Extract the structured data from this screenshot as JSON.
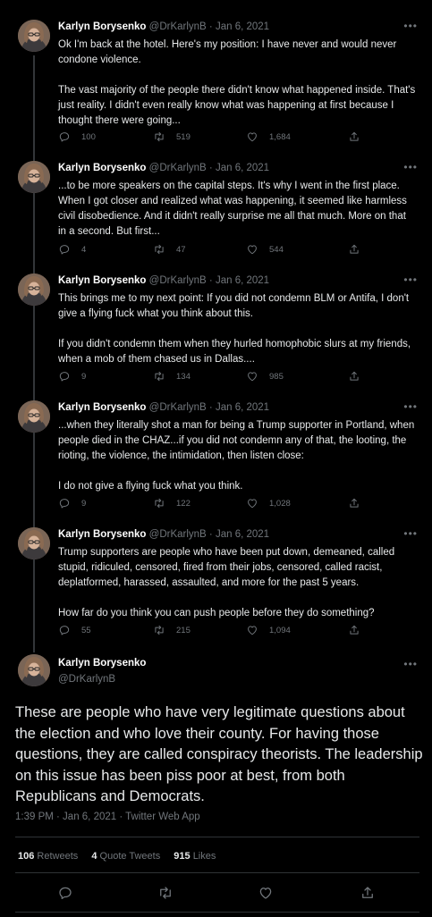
{
  "tweets": [
    {
      "author": "Karlyn Borysenko",
      "handle": "@DrKarlynB",
      "date": "Jan 6, 2021",
      "paragraphs": [
        "Ok I'm back at the hotel. Here's my position: I have never and would never condone violence.",
        "The vast majority of the people there didn't know what happened inside. That's just reality. I didn't even really know what was happening at first because I thought there were going..."
      ],
      "replies": "100",
      "retweets": "519",
      "likes": "1,684"
    },
    {
      "author": "Karlyn Borysenko",
      "handle": "@DrKarlynB",
      "date": "Jan 6, 2021",
      "paragraphs": [
        "...to be more speakers on the capital steps. It's why I went in the first place. When I got closer and realized what was happening, it seemed like harmless civil disobedience. And it didn't really surprise me all that much. More on that in a second. But first..."
      ],
      "replies": "4",
      "retweets": "47",
      "likes": "544"
    },
    {
      "author": "Karlyn Borysenko",
      "handle": "@DrKarlynB",
      "date": "Jan 6, 2021",
      "paragraphs": [
        "This brings me to my next point: If you did not condemn BLM or Antifa, I don't give a flying fuck what you think about this.",
        "If you didn't condemn them when they hurled homophobic slurs at my friends, when a mob of them chased us in Dallas...."
      ],
      "replies": "9",
      "retweets": "134",
      "likes": "985"
    },
    {
      "author": "Karlyn Borysenko",
      "handle": "@DrKarlynB",
      "date": "Jan 6, 2021",
      "paragraphs": [
        "...when they literally shot a man for being a Trump supporter in Portland, when people died in the CHAZ...if you did not condemn any of that, the looting, the rioting, the violence, the intimidation, then listen close:",
        "I do not give a flying fuck what you think."
      ],
      "replies": "9",
      "retweets": "122",
      "likes": "1,028"
    },
    {
      "author": "Karlyn Borysenko",
      "handle": "@DrKarlynB",
      "date": "Jan 6, 2021",
      "paragraphs": [
        "Trump supporters are people who have been put down, demeaned, called stupid, ridiculed, censored, fired from their jobs, censored, called racist, deplatformed, harassed, assaulted, and more for the past 5 years.",
        "How far do you think you can push people before they do something?"
      ],
      "replies": "55",
      "retweets": "215",
      "likes": "1,094"
    }
  ],
  "main": {
    "author": "Karlyn Borysenko",
    "handle": "@DrKarlynB",
    "text": "These are people who have very legitimate questions about the election and who love their county. For having those questions, they are called conspiracy theorists. The leadership on this issue has been piss poor at best, from both Republicans and Democrats.",
    "timestamp": "1:39 PM · Jan 6, 2021 · Twitter Web App",
    "retweets_count": "106",
    "retweets_label": "Retweets",
    "quotes_count": "4",
    "quotes_label": "Quote Tweets",
    "likes_count": "915",
    "likes_label": "Likes"
  },
  "ui": {
    "separator": "·",
    "more_glyph": "•••",
    "icons": [
      "reply-icon",
      "retweet-icon",
      "like-icon",
      "share-icon",
      "more-icon"
    ],
    "colors": {
      "background": "#000000",
      "text": "#e7e9ea",
      "muted": "#71767b",
      "divider": "#2f3336"
    }
  }
}
